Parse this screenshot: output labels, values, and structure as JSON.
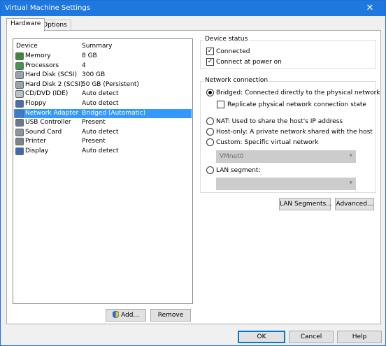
{
  "window": {
    "title": "Virtual Machine Settings",
    "close_glyph": "✕"
  },
  "tabs": [
    {
      "label": "Hardware",
      "active": true
    },
    {
      "label": "Options",
      "active": false
    }
  ],
  "device_list": {
    "col_device": "Device",
    "col_summary": "Summary",
    "items": [
      {
        "name": "Memory",
        "summary": "8 GB",
        "icon": "memory-icon"
      },
      {
        "name": "Processors",
        "summary": "4",
        "icon": "processor-icon"
      },
      {
        "name": "Hard Disk (SCSI)",
        "summary": "300 GB",
        "icon": "hard-disk-icon"
      },
      {
        "name": "Hard Disk 2 (SCSI)",
        "summary": "50 GB (Persistent)",
        "icon": "hard-disk-icon"
      },
      {
        "name": "CD/DVD (IDE)",
        "summary": "Auto detect",
        "icon": "cd-dvd-icon"
      },
      {
        "name": "Floppy",
        "summary": "Auto detect",
        "icon": "floppy-icon"
      },
      {
        "name": "Network Adapter",
        "summary": "Bridged (Automatic)",
        "icon": "network-adapter-icon",
        "selected": true
      },
      {
        "name": "USB Controller",
        "summary": "Present",
        "icon": "usb-icon"
      },
      {
        "name": "Sound Card",
        "summary": "Auto detect",
        "icon": "sound-card-icon"
      },
      {
        "name": "Printer",
        "summary": "Present",
        "icon": "printer-icon"
      },
      {
        "name": "Display",
        "summary": "Auto detect",
        "icon": "display-icon"
      }
    ],
    "selection_color": "#3399ff"
  },
  "list_buttons": {
    "add_label": "Add...",
    "remove_label": "Remove"
  },
  "device_status": {
    "legend": "Device status",
    "connected_label": "Connected",
    "connected_checked": true,
    "power_on_label": "Connect at power on",
    "power_on_checked": true
  },
  "network_connection": {
    "legend": "Network connection",
    "bridged_label": "Bridged: Connected directly to the physical network",
    "replicate_label": "Replicate physical network connection state",
    "nat_label": "NAT: Used to share the host's IP address",
    "host_only_label": "Host-only: A private network shared with the host",
    "custom_label": "Custom: Specific virtual network",
    "vmnet_value": "VMnet0",
    "lan_segment_label": "LAN segment:",
    "lan_segment_value": "",
    "selected": "bridged"
  },
  "net_buttons": {
    "lan_segments_label": "LAN Segments...",
    "advanced_label": "Advanced..."
  },
  "footer": {
    "ok_label": "OK",
    "cancel_label": "Cancel",
    "help_label": "Help"
  },
  "colors": {
    "titlebar": "#1f77e0",
    "accent": "#0078d7"
  }
}
